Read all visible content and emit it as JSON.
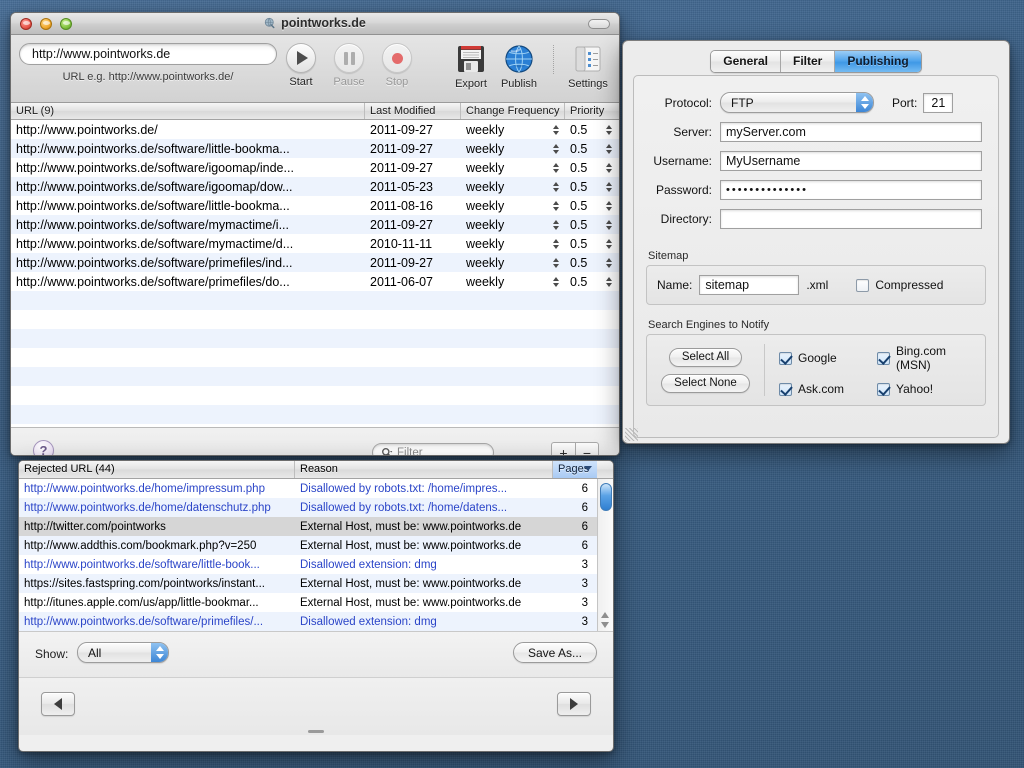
{
  "desktop": {
    "background_color": "#3d6287"
  },
  "main_window": {
    "title": "pointworks.de",
    "title_icon": "globe-link-icon",
    "url_field": {
      "value": "http://www.pointworks.de",
      "placeholder": "http://www.pointworks.de/"
    },
    "url_hint": "URL e.g. http://www.pointworks.de/",
    "toolbar": [
      {
        "name": "start",
        "label": "Start",
        "icon": "play-icon",
        "enabled": true
      },
      {
        "name": "pause",
        "label": "Pause",
        "icon": "pause-icon",
        "enabled": false
      },
      {
        "name": "stop",
        "label": "Stop",
        "icon": "record-stop-icon",
        "enabled": false
      },
      {
        "name": "export",
        "label": "Export",
        "icon": "floppy-disk-icon",
        "enabled": true
      },
      {
        "name": "publish",
        "label": "Publish",
        "icon": "globe-icon",
        "enabled": true
      },
      {
        "name": "settings",
        "label": "Settings",
        "icon": "settings-panel-icon",
        "enabled": true
      }
    ],
    "table": {
      "columns": [
        "URL (9)",
        "Last Modified",
        "Change Frequency",
        "Priority"
      ],
      "rows": [
        {
          "url": "http://www.pointworks.de/",
          "modified": "2011-09-27",
          "frequency": "weekly",
          "priority": "0.5"
        },
        {
          "url": "http://www.pointworks.de/software/little-bookma...",
          "modified": "2011-09-27",
          "frequency": "weekly",
          "priority": "0.5"
        },
        {
          "url": "http://www.pointworks.de/software/igoomap/inde...",
          "modified": "2011-09-27",
          "frequency": "weekly",
          "priority": "0.5"
        },
        {
          "url": "http://www.pointworks.de/software/igoomap/dow...",
          "modified": "2011-05-23",
          "frequency": "weekly",
          "priority": "0.5"
        },
        {
          "url": "http://www.pointworks.de/software/little-bookma...",
          "modified": "2011-08-16",
          "frequency": "weekly",
          "priority": "0.5"
        },
        {
          "url": "http://www.pointworks.de/software/mymactime/i...",
          "modified": "2011-09-27",
          "frequency": "weekly",
          "priority": "0.5"
        },
        {
          "url": "http://www.pointworks.de/software/mymactime/d...",
          "modified": "2010-11-11",
          "frequency": "weekly",
          "priority": "0.5"
        },
        {
          "url": "http://www.pointworks.de/software/primefiles/ind...",
          "modified": "2011-09-27",
          "frequency": "weekly",
          "priority": "0.5"
        },
        {
          "url": "http://www.pointworks.de/software/primefiles/do...",
          "modified": "2011-06-07",
          "frequency": "weekly",
          "priority": "0.5"
        }
      ]
    },
    "bottom_bar": {
      "help_label": "?",
      "filter_placeholder": "Filter",
      "filter_value": "",
      "add_label": "+",
      "remove_label": "−"
    }
  },
  "rejected_window": {
    "columns": [
      "Rejected URL (44)",
      "Reason",
      "Pages"
    ],
    "sorted_column": "Pages",
    "rows": [
      {
        "url": "http://www.pointworks.de/home/impressum.php",
        "reason": "Disallowed by robots.txt: /home/impres...",
        "pages": "6",
        "link": true,
        "selected": false
      },
      {
        "url": "http://www.pointworks.de/home/datenschutz.php",
        "reason": "Disallowed by robots.txt: /home/datens...",
        "pages": "6",
        "link": true,
        "selected": false
      },
      {
        "url": "http://twitter.com/pointworks",
        "reason": "External Host, must be: www.pointworks.de",
        "pages": "6",
        "link": false,
        "selected": true
      },
      {
        "url": "http://www.addthis.com/bookmark.php?v=250",
        "reason": "External Host, must be: www.pointworks.de",
        "pages": "6",
        "link": false,
        "selected": false
      },
      {
        "url": "http://www.pointworks.de/software/little-book...",
        "reason": "Disallowed extension: dmg",
        "pages": "3",
        "link": true,
        "selected": false
      },
      {
        "url": "https://sites.fastspring.com/pointworks/instant...",
        "reason": "External Host, must be: www.pointworks.de",
        "pages": "3",
        "link": false,
        "selected": false
      },
      {
        "url": "http://itunes.apple.com/us/app/little-bookmar...",
        "reason": "External Host, must be: www.pointworks.de",
        "pages": "3",
        "link": false,
        "selected": false
      },
      {
        "url": "http://www.pointworks.de/software/primefiles/...",
        "reason": "Disallowed extension: dmg",
        "pages": "3",
        "link": true,
        "selected": false
      }
    ],
    "show_label": "Show:",
    "show_value": "All",
    "save_as_label": "Save As...",
    "prev_label": "◀",
    "next_label": "▶"
  },
  "settings_window": {
    "tabs": [
      {
        "label": "General",
        "active": false
      },
      {
        "label": "Filter",
        "active": false
      },
      {
        "label": "Publishing",
        "active": true
      }
    ],
    "publishing": {
      "protocol_label": "Protocol:",
      "protocol_value": "FTP",
      "port_label": "Port:",
      "port_value": "21",
      "server_label": "Server:",
      "server_value": "myServer.com",
      "username_label": "Username:",
      "username_value": "MyUsername",
      "password_label": "Password:",
      "password_value": "••••••••••••••",
      "directory_label": "Directory:",
      "directory_value": "",
      "sitemap_group": "Sitemap",
      "sitemap_name_label": "Name:",
      "sitemap_name_value": "sitemap",
      "sitemap_extension": ".xml",
      "compressed_label": "Compressed",
      "compressed_checked": false,
      "engines_group": "Search Engines to Notify",
      "select_all_label": "Select All",
      "select_none_label": "Select None",
      "engines": [
        {
          "label": "Google",
          "checked": true
        },
        {
          "label": "Bing.com (MSN)",
          "checked": true
        },
        {
          "label": "Ask.com",
          "checked": true
        },
        {
          "label": "Yahoo!",
          "checked": true
        }
      ]
    }
  }
}
